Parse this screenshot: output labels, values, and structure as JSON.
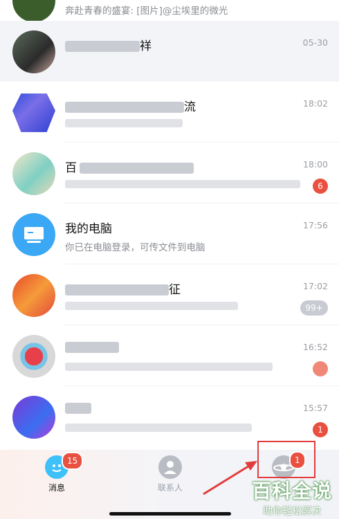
{
  "conversations": [
    {
      "name": "",
      "preview": "奔赴青春的盛宴: [图片]@尘埃里的微光",
      "time": "",
      "badge": ""
    },
    {
      "name": "祥",
      "preview": "",
      "time": "05-30",
      "badge": ""
    },
    {
      "name": "流",
      "preview": "",
      "time": "18:02",
      "badge": ""
    },
    {
      "name": "百",
      "preview": "",
      "time": "18:00",
      "badge": "6"
    },
    {
      "name": "我的电脑",
      "preview": "你已在电脑登录，可传文件到电脑",
      "time": "17:56",
      "badge": ""
    },
    {
      "name": "征",
      "preview": "",
      "time": "17:02",
      "badge": "99+"
    },
    {
      "name": "",
      "preview": "",
      "time": "16:52",
      "badge": ""
    },
    {
      "name": "",
      "preview": "",
      "time": "15:57",
      "badge": "1"
    }
  ],
  "tabs": {
    "messages": {
      "label": "消息",
      "badge": "15"
    },
    "contacts": {
      "label": "联系人"
    },
    "explore": {
      "label": "",
      "badge": "1"
    }
  },
  "watermark": {
    "title": "百科全说",
    "subtitle": "助你轻松解决"
  },
  "colors": {
    "badge": "#e9503f",
    "highlight": "#e23b3b",
    "accent": "#1aaefc"
  }
}
